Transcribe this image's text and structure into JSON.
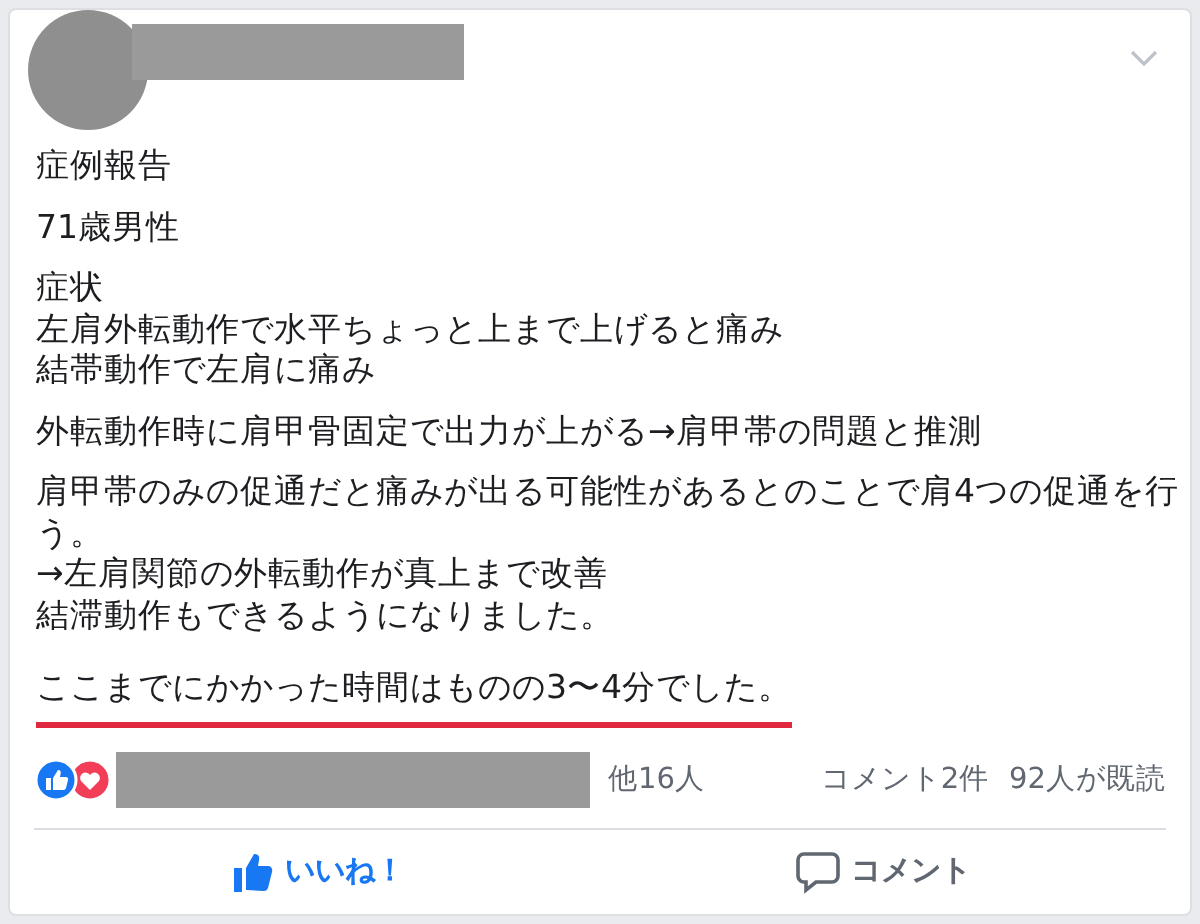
{
  "post": {
    "paragraphs": [
      {
        "lines": [
          "症例報告"
        ],
        "underlined": false
      },
      {
        "lines": [
          "71歳男性"
        ],
        "underlined": false
      },
      {
        "lines": [
          "症状",
          "左肩外転動作で水平ちょっと上まで上げると痛み",
          "結帯動作で左肩に痛み"
        ],
        "underlined": false
      },
      {
        "lines": [
          "外転動作時に肩甲骨固定で出力が上がる→肩甲帯の問題と推測"
        ],
        "underlined": false
      },
      {
        "lines": [
          "肩甲帯のみの促通だと痛みが出る可能性があるとのことで肩4つの促通を行う。",
          "→左肩関節の外転動作が真上まで改善",
          "結滞動作もできるようになりました。"
        ],
        "underlined": false
      },
      {
        "lines": [
          "ここまでにかかった時間はものの3〜4分でした。"
        ],
        "underlined": true
      }
    ]
  },
  "reactions": {
    "others": "他16人",
    "comments": "コメント2件",
    "views": "92人が既読"
  },
  "actions": [
    {
      "kind": "like",
      "label": "いいね！",
      "active": true
    },
    {
      "kind": "comment",
      "label": "コメント",
      "active": false
    }
  ]
}
